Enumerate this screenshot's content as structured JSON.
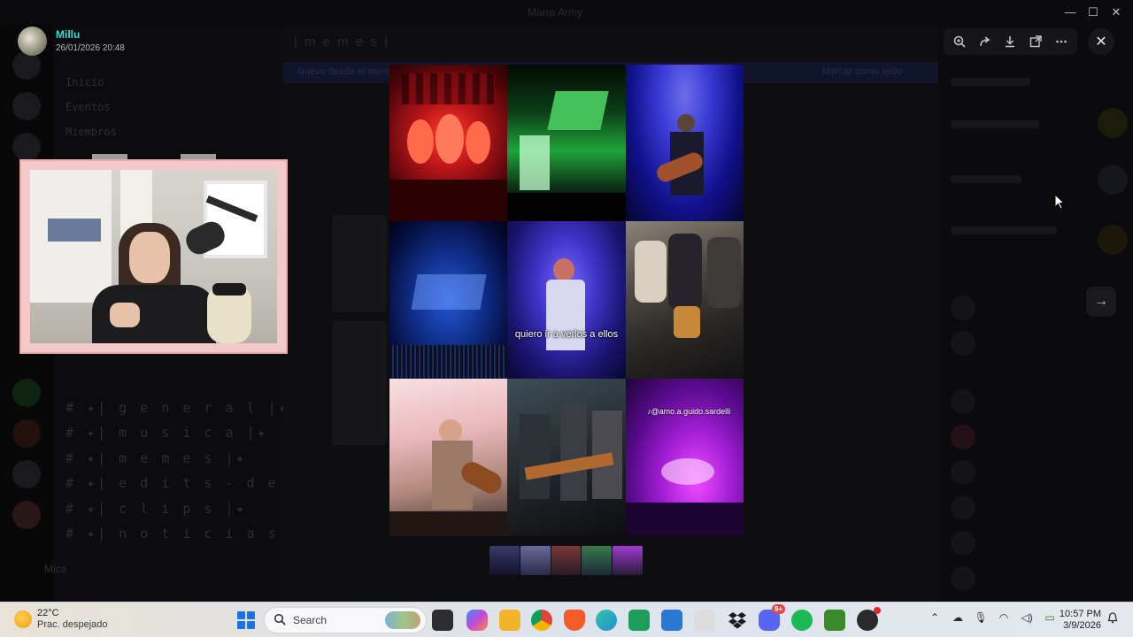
{
  "window": {
    "title": "Marra Army",
    "controls": [
      "—",
      "☐",
      "✕"
    ]
  },
  "background": {
    "channel_categories": [
      "Inicio",
      "Eventos",
      "Miembros"
    ],
    "channels": [
      "# ✦| g e n e r a l |✦",
      "# ✦| m u s i c a |✦",
      "# ✦| m e m e s |✦",
      "# ✦| e d i t s - d e - m u ...",
      "# ✦| c l i p s |✦",
      "# ✦| n o t i c i a s - d e ..."
    ],
    "current_channel": "| m e m e s |",
    "current_user": "Mica",
    "banner_left": "Nuevo desde el mensaje",
    "banner_right": "Marcar como leído"
  },
  "viewer": {
    "uploader_name": "Millu",
    "uploader_date": "26/01/2026 20:48",
    "toolbar_icons": [
      "zoom-in-icon",
      "forward-icon",
      "download-icon",
      "open-external-icon",
      "more-icon"
    ],
    "close_label": "✕",
    "next_label": "→",
    "caption": "quiero ir a verlos a ellos",
    "watermark": "♪@amo.a.guido.sardelli",
    "thumbnail_count": 5
  },
  "taskbar": {
    "weather_temp": "22°C",
    "weather_desc": "Prac. despejado",
    "search_placeholder": "Search",
    "apps": [
      {
        "name": "task-view",
        "color": "#3a3a3e"
      },
      {
        "name": "copilot",
        "color": "#9a5bd6"
      },
      {
        "name": "file-explorer",
        "color": "#f3b42a"
      },
      {
        "name": "chrome",
        "color": "#e04a3a"
      },
      {
        "name": "brave",
        "color": "#f45a2a"
      },
      {
        "name": "edge",
        "color": "#1f8fd8"
      },
      {
        "name": "green-app",
        "color": "#1d9e5a"
      },
      {
        "name": "microsoft-store",
        "color": "#2a78d2"
      },
      {
        "name": "amazon",
        "color": "#dcdcdc"
      },
      {
        "name": "dropbox",
        "color": "#1a60d8"
      },
      {
        "name": "discord",
        "color": "#5865f2"
      },
      {
        "name": "spotify",
        "color": "#1db954"
      },
      {
        "name": "minecraft",
        "color": "#3a8a2c"
      },
      {
        "name": "obs",
        "color": "#2a2a2a"
      }
    ],
    "discord_badge": "9+",
    "time": "10:57 PM",
    "date": "3/9/2026"
  }
}
